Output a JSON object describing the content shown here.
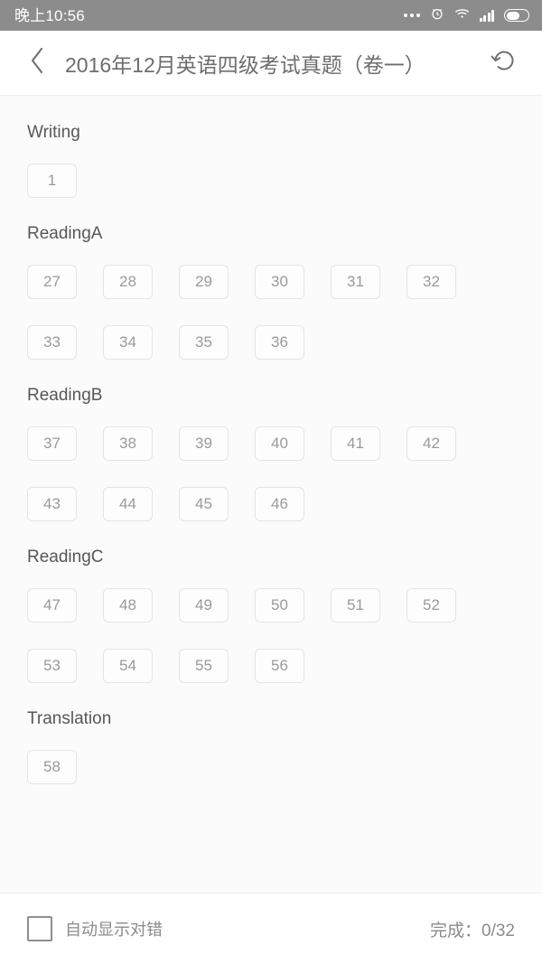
{
  "status_bar": {
    "time": "晚上10:56",
    "icons": [
      "more-dots-icon",
      "alarm-clock-icon",
      "wifi-icon",
      "signal-bars-icon",
      "battery-icon"
    ],
    "background": "#8c8c8c"
  },
  "header": {
    "back_icon": "chevron-left-icon",
    "title": "2016年12月英语四级考试真题（卷一）",
    "refresh_icon": "reset-refresh-icon"
  },
  "sections": [
    {
      "title": "Writing",
      "questions": [
        "1"
      ]
    },
    {
      "title": "ReadingA",
      "questions": [
        "27",
        "28",
        "29",
        "30",
        "31",
        "32",
        "33",
        "34",
        "35",
        "36"
      ]
    },
    {
      "title": "ReadingB",
      "questions": [
        "37",
        "38",
        "39",
        "40",
        "41",
        "42",
        "43",
        "44",
        "45",
        "46"
      ]
    },
    {
      "title": "ReadingC",
      "questions": [
        "47",
        "48",
        "49",
        "50",
        "51",
        "52",
        "53",
        "54",
        "55",
        "56"
      ]
    },
    {
      "title": "Translation",
      "questions": [
        "58"
      ]
    }
  ],
  "bottom_bar": {
    "checkbox_checked": false,
    "auto_label": "自动显示对错",
    "progress_label": "完成：0/32"
  },
  "theme": {
    "page_background": "#fbfbfb",
    "button_border": "#e4e4e4",
    "button_text": "#9a9a9a",
    "section_title": "#575757",
    "muted_text": "#8b8b8b"
  }
}
